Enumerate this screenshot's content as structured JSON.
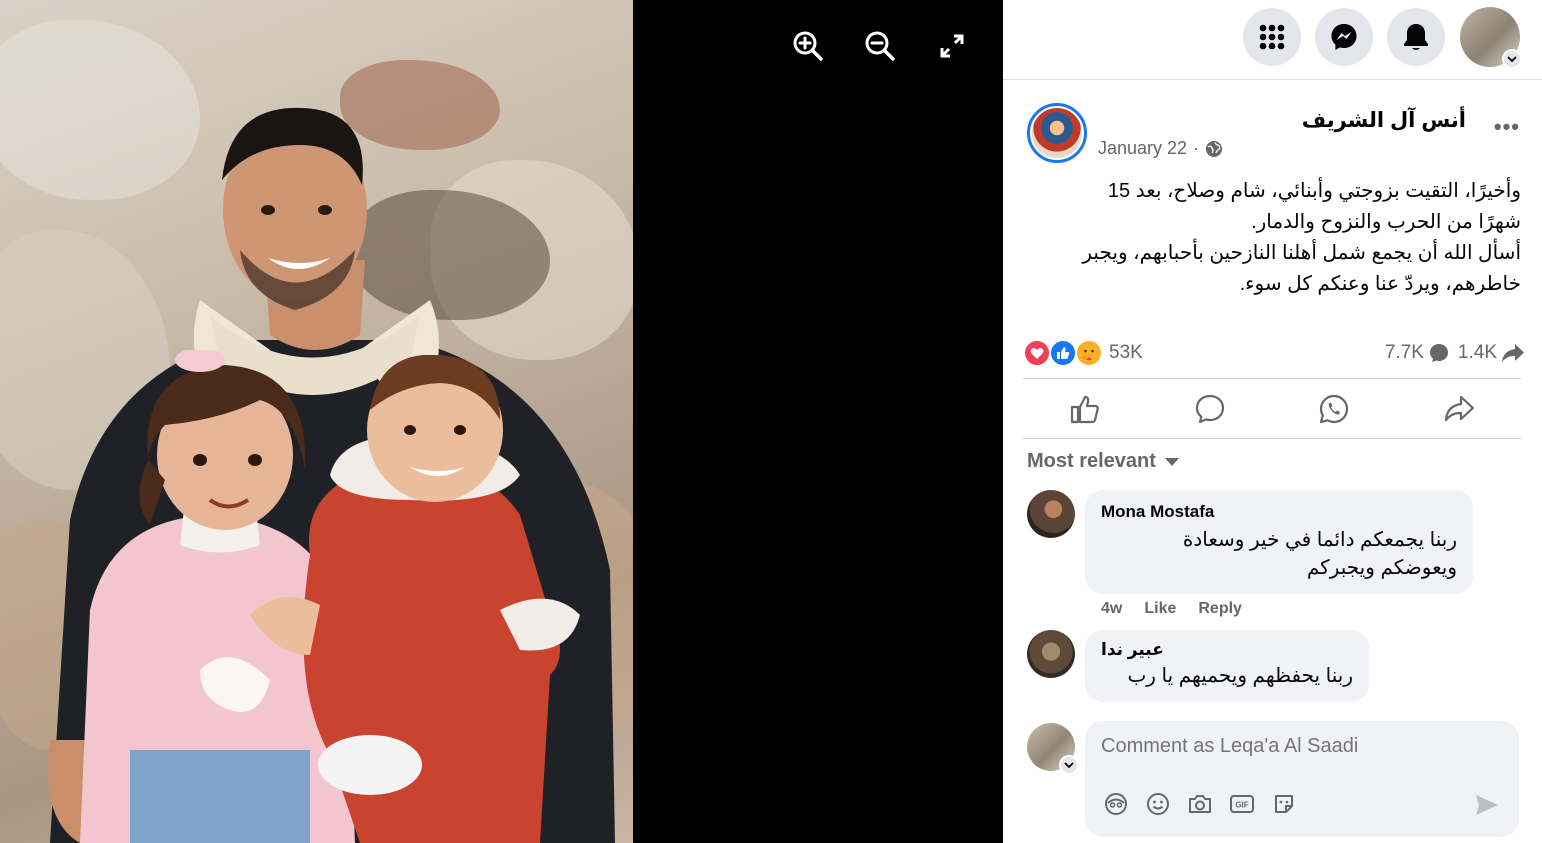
{
  "viewer": {
    "controls": [
      {
        "name": "zoom-in-icon"
      },
      {
        "name": "zoom-out-icon"
      },
      {
        "name": "fullscreen-icon"
      }
    ]
  },
  "topbar": {
    "icons": [
      "menu-grid-icon",
      "messenger-icon",
      "notifications-bell-icon"
    ]
  },
  "post": {
    "author": "أنس آل الشريف",
    "date": "January 22",
    "date_sep": "·",
    "text_line1": "وأخيرًا، التقيت بزوجتي وأبنائي، شام وصلاح، بعد 15",
    "text_line2": "شهرًا من الحرب والنزوح والدمار.",
    "text_line3": "أسأل الله أن يجمع شمل أهلنا النازحين بأحبابهم، ويجبر",
    "text_line4": "خاطرهم، ويردّ عنا وعنكم كل سوء.",
    "reactions_count": "53K",
    "comments_count": "7.7K",
    "shares_count": "1.4K"
  },
  "sort_label": "Most relevant",
  "comments": [
    {
      "name": "Mona Mostafa",
      "text_line1": "ربنا يجمعكم دائما في خير وسعادة",
      "text_line2": "ويعوضكم ويجبركم",
      "time": "4w",
      "like": "Like",
      "reply": "Reply"
    },
    {
      "name": "عبير ندا",
      "text_line1": "ربنا يحفظهم ويحميهم يا رب"
    }
  ],
  "composer": {
    "placeholder": "Comment as Leqa'a Al Saadi"
  },
  "colors": {
    "brand_blue": "#1877f2",
    "love_red": "#f33e58",
    "care_yellow": "#f7b125"
  }
}
